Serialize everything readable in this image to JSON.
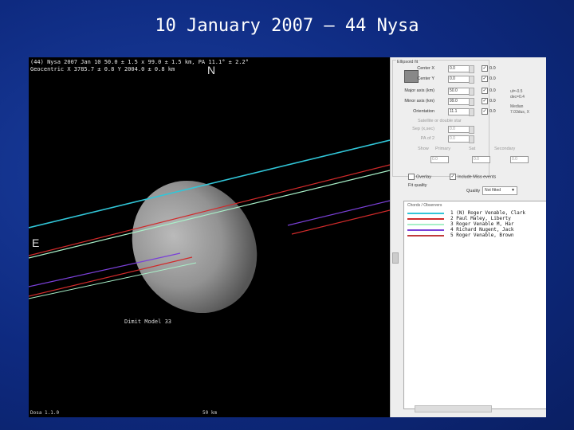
{
  "slide": {
    "title": "10 January 2007 – 44 Nysa"
  },
  "plot": {
    "header_line1": "(44) Nysa  2007 Jan 10   50.0 ± 1.5 x 99.0 ± 1.5 km, PA  11.1° ± 2.2°",
    "header_line2": "Geocentric X  3785.7 ± 0.8  Y 2004.0 ± 0.8 km",
    "north_label": "N",
    "east_label": "E",
    "model_label": "Dimit Model  33",
    "footer_left": "Dosa 1.1.0",
    "footer_scale": "50 km",
    "colors": {
      "background": "#000000",
      "ellipsoid": "#9a9a9a"
    },
    "chord_lines": [
      {
        "name": "cyan-chord",
        "color": "#31c6d8"
      },
      {
        "name": "red-chord-1",
        "color": "#d02a2a"
      },
      {
        "name": "mint-chord",
        "color": "#a8f0c8"
      },
      {
        "name": "purple-chord",
        "color": "#7a40d8"
      },
      {
        "name": "red-chord-2",
        "color": "#d02a2a"
      }
    ]
  },
  "panel": {
    "group_title": "Ellipsoid fit",
    "fields": [
      {
        "label": "Center X",
        "value": "0.0",
        "checked": true,
        "check_val": "0.0"
      },
      {
        "label": "Center Y",
        "value": "0.0",
        "checked": true,
        "check_val": "0.0"
      },
      {
        "label": "Major axis (km)",
        "value": "50.0",
        "checked": true,
        "check_val": "0.0"
      },
      {
        "label": "Minor axis (km)",
        "value": "99.0",
        "checked": true,
        "check_val": "0.0"
      },
      {
        "label": "Orientation",
        "value": "11.1",
        "checked": true,
        "check_val": "0.0"
      }
    ],
    "secondary_title": "Satellite or double star",
    "secondary_fields": [
      {
        "label": "Sep (x,sec)",
        "value": "0.0"
      },
      {
        "label": "PA of 2",
        "value": "0.0"
      }
    ],
    "show_label": "Show",
    "show_options": [
      "Primary",
      "Sat",
      "Secondary"
    ],
    "show_row2_values": [
      "0.0",
      "0.0",
      "0.0"
    ],
    "side_note_1": "ul=-0.5",
    "side_note_2": "dec=0.4",
    "side_note_3": "Median",
    "side_note_4": "7.03dus, X",
    "overlay_label": "Overlay",
    "include_misses_label": "Include Miss events",
    "profile_label": "Fit quality",
    "quality_label": "Quality",
    "quality_value": "Not fitted",
    "chords_header": "Chords / Observers",
    "chords": [
      {
        "num": "1 (N)",
        "observer": "Roger Venable, Clark",
        "color": "#31c6d8"
      },
      {
        "num": "2",
        "observer": "Paul Maley, Liberty",
        "color": "#d02a2a"
      },
      {
        "num": "3",
        "observer": "Roger Venable M, Har",
        "color": "#a8f0c8"
      },
      {
        "num": "4",
        "observer": "Richard Nugent, Jack",
        "color": "#7a40d8"
      },
      {
        "num": "5",
        "observer": "Roger Venable, Brown",
        "color": "#c03a3a"
      }
    ]
  }
}
